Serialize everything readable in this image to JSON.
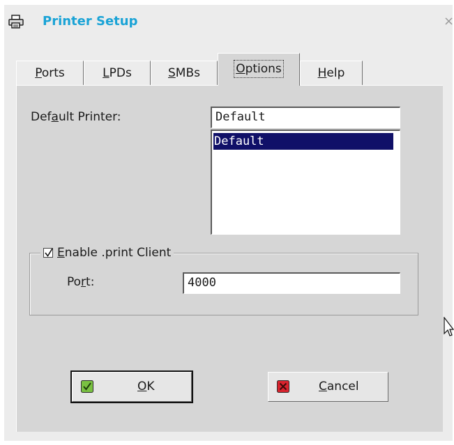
{
  "window": {
    "title": "Printer Setup",
    "icons": {
      "title": "printer-icon",
      "close": "close-icon"
    },
    "close_glyph": "×"
  },
  "tabs": [
    {
      "id": "ports",
      "pre": "",
      "mnemonic": "P",
      "post": "orts",
      "active": false
    },
    {
      "id": "lpds",
      "pre": "",
      "mnemonic": "L",
      "post": "PDs",
      "active": false
    },
    {
      "id": "smbs",
      "pre": "",
      "mnemonic": "S",
      "post": "MBs",
      "active": false
    },
    {
      "id": "options",
      "pre": "",
      "mnemonic": "O",
      "post": "ptions",
      "active": true
    },
    {
      "id": "help",
      "pre": "",
      "mnemonic": "H",
      "post": "elp",
      "active": false
    }
  ],
  "options": {
    "default_printer": {
      "label_pre": "Def",
      "label_mnemonic": "a",
      "label_post": "ult Printer:",
      "value": "Default",
      "list": [
        "Default"
      ],
      "selected": "Default"
    },
    "print_client": {
      "checked": true,
      "label_pre": "",
      "label_mnemonic": "E",
      "label_post": "nable .print Client",
      "port_label_pre": "Po",
      "port_label_mnemonic": "r",
      "port_label_post": "t:",
      "port_value": "4000"
    }
  },
  "buttons": {
    "ok": {
      "mnemonic": "O",
      "post": "K",
      "icon": "check-icon",
      "is_default": true
    },
    "cancel": {
      "mnemonic": "C",
      "post": "ancel",
      "icon": "cancel-x-icon",
      "is_default": false
    }
  },
  "colors": {
    "title": "#1aa3d6",
    "selection": "#101068",
    "ok_icon": "#7ac142",
    "cancel_icon": "#d9232e"
  }
}
